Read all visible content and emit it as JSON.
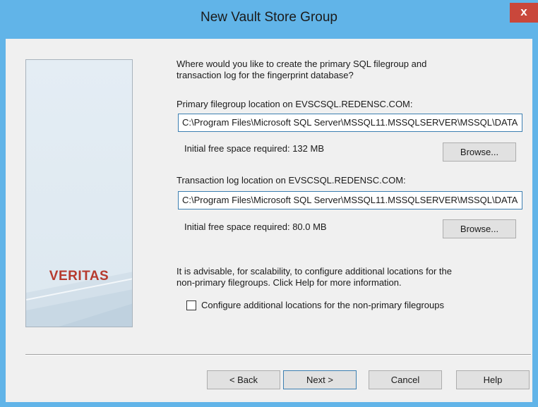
{
  "window": {
    "title": "New Vault Store Group",
    "close_label": "x"
  },
  "sidebar": {
    "logo": "VERITAS"
  },
  "content": {
    "question_line1": "Where would you like to create the primary SQL filegroup and",
    "question_line2": "transaction log for the fingerprint database?",
    "primary": {
      "label": "Primary filegroup location on EVSCSQL.REDENSC.COM:",
      "value": "C:\\Program Files\\Microsoft SQL Server\\MSSQL11.MSSQLSERVER\\MSSQL\\DATA",
      "space": "Initial free space required: 132 MB",
      "browse": "Browse..."
    },
    "log": {
      "label": "Transaction log location on EVSCSQL.REDENSC.COM:",
      "value": "C:\\Program Files\\Microsoft SQL Server\\MSSQL11.MSSQLSERVER\\MSSQL\\DATA",
      "space": "Initial free space required: 80.0 MB",
      "browse": "Browse..."
    },
    "advice_line1": "It is advisable, for scalability, to configure additional locations for the",
    "advice_line2": "non-primary filegroups. Click Help for more information.",
    "checkbox_label": "Configure additional locations for the non-primary filegroups",
    "checkbox_checked": false
  },
  "footer": {
    "back": "< Back",
    "next": "Next >",
    "cancel": "Cancel",
    "help": "Help"
  },
  "colors": {
    "titlebar": "#61b4e8",
    "close": "#c9473b",
    "logo": "#b63a2e",
    "focus_border": "#3c7fb1"
  }
}
